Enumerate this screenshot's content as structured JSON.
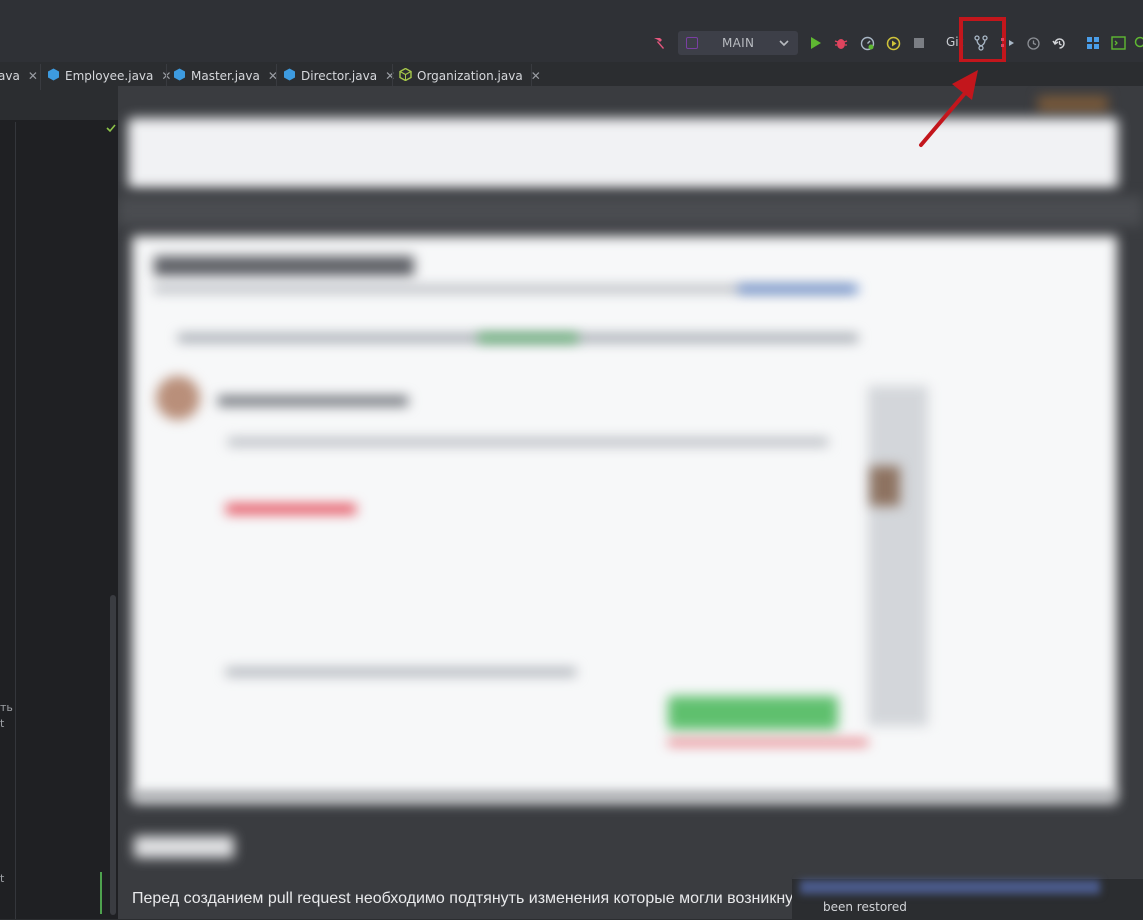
{
  "toolbar": {
    "run_config_label": "MAIN",
    "git_label": "Git",
    "colors": {
      "highlight": "#c3161c",
      "run": "#5fb832",
      "debug": "#e0445e",
      "build": "#e5577e",
      "git_branch": "#a9b7c6"
    },
    "icons": [
      "build-hammer-icon",
      "run-config-icon",
      "run-icon",
      "debug-icon",
      "profiler-icon",
      "coverage-icon",
      "stop-icon",
      "git-branches-icon",
      "git-push-icon",
      "history-icon",
      "rollback-icon",
      "layout-icon",
      "terminal-icon",
      "search-icon"
    ]
  },
  "tabs": [
    {
      "label": "ava",
      "icon": "class-icon"
    },
    {
      "label": "Employee.java",
      "icon": "class-icon"
    },
    {
      "label": "Master.java",
      "icon": "class-icon"
    },
    {
      "label": "Director.java",
      "icon": "class-icon"
    },
    {
      "label": "Organization.java",
      "icon": "abstract-class-icon"
    }
  ],
  "editor": {
    "edge_text_1": "ть",
    "edge_text_2": "t",
    "edge_text_3": "t"
  },
  "content": {
    "paragraph": "Перед созданием pull request необходимо подтянуть изменения которые могли возникну"
  },
  "notification": {
    "text": "been restored"
  }
}
